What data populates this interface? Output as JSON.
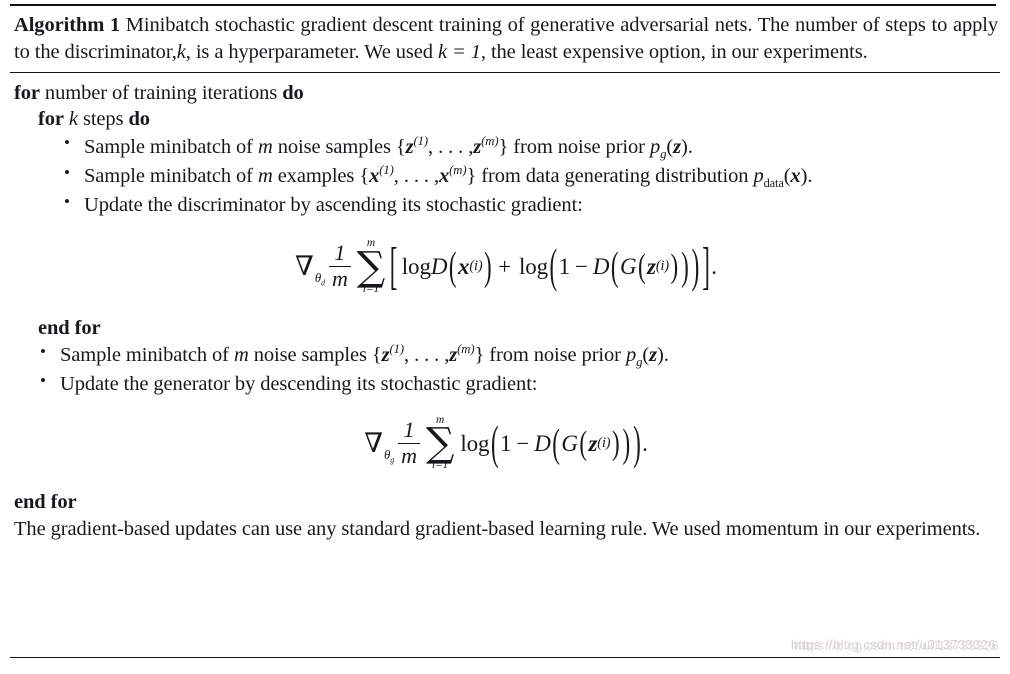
{
  "document": {
    "type": "algorithm-figure",
    "background_color": "#ffffff",
    "text_color": "#18181c",
    "rule_color": "#111118"
  },
  "caption": {
    "algorithm_label": "Algorithm 1",
    "title_part": "Minibatch stochastic gradient descent training of generative adversarial nets.",
    "note_part": "The number of steps to apply to the discriminator,",
    "k_symbol": "k",
    "note_mid": ", is a hyperparameter. We used",
    "k_value": "k = 1",
    "note_end": ", the least expensive option, in our experiments."
  },
  "algorithm": {
    "line_for_outer_pre": "for",
    "line_for_outer_text": "number of training iterations",
    "line_for_outer_post": "do",
    "line_for_inner_pre": "for",
    "line_for_inner_sym": "k",
    "line_for_inner_text": "steps",
    "line_for_inner_post": "do",
    "bullet1": {
      "text_a": "Sample minibatch of",
      "sym_m": "m",
      "text_b": "noise samples",
      "set_open": "{",
      "var1": "z",
      "sup1": "(1)",
      "ellipsis": ", . . . ,",
      "var2": "z",
      "sup2": "(m)",
      "set_close": "}",
      "text_c": "from noise prior",
      "prior_p": "p",
      "prior_sub": "g",
      "prior_arg_open": "(",
      "prior_arg": "z",
      "prior_arg_close": ")",
      "period": "."
    },
    "bullet2": {
      "text_a": "Sample minibatch of",
      "sym_m": "m",
      "text_b": "examples",
      "set_open": "{",
      "var1": "x",
      "sup1": "(1)",
      "ellipsis": ", . . . ,",
      "var2": "x",
      "sup2": "(m)",
      "set_close": "}",
      "text_c": "from data generating distribution",
      "dist_p": "p",
      "dist_sub": "data",
      "dist_arg_open": "(",
      "dist_arg": "x",
      "dist_arg_close": ")",
      "period": "."
    },
    "bullet3": {
      "text": "Update the discriminator by ascending its stochastic gradient:"
    },
    "end_for_inner": "end for",
    "bullet4": {
      "text_a": "Sample minibatch of",
      "sym_m": "m",
      "text_b": "noise samples",
      "set_open": "{",
      "var1": "z",
      "sup1": "(1)",
      "ellipsis": ", . . . ,",
      "var2": "z",
      "sup2": "(m)",
      "set_close": "}",
      "text_c": "from noise prior",
      "prior_p": "p",
      "prior_sub": "g",
      "prior_arg_open": "(",
      "prior_arg": "z",
      "prior_arg_close": ")",
      "period": "."
    },
    "bullet5": {
      "text": "Update the generator by descending its stochastic gradient:"
    },
    "end_for_outer": "end for",
    "closing_text": "The gradient-based updates can use any standard gradient-based learning rule. We used momentum in our experiments."
  },
  "equations": {
    "discriminator": {
      "latex": "\\nabla_{\\theta_d} \\frac{1}{m} \\sum_{i=1}^{m} \\left[ \\log D\\left(x^{(i)}\\right) + \\log\\left(1 - D\\left(G\\left(z^{(i)}\\right)\\right)\\right) \\right].",
      "nabla": "∇",
      "nabla_sub_theta": "θ",
      "nabla_sub_index": "d",
      "frac_num": "1",
      "frac_den": "m",
      "sum_symbol": "∑",
      "sum_upper": "m",
      "sum_lower": "i=1",
      "bracket_open": "[",
      "log1": "log",
      "func_D": "D",
      "paren_open": "(",
      "var_x": "x",
      "sup_i": "(i)",
      "paren_close": ")",
      "plus": "+",
      "log2": "log",
      "one": "1",
      "minus": "−",
      "func_D2": "D",
      "func_G": "G",
      "var_z": "z",
      "bracket_close": "]",
      "period": "."
    },
    "generator": {
      "latex": "\\nabla_{\\theta_g} \\frac{1}{m} \\sum_{i=1}^{m} \\log\\left(1 - D\\left(G\\left(z^{(i)}\\right)\\right)\\right).",
      "nabla": "∇",
      "nabla_sub_theta": "θ",
      "nabla_sub_index": "g",
      "frac_num": "1",
      "frac_den": "m",
      "sum_symbol": "∑",
      "sum_upper": "m",
      "sum_lower": "i=1",
      "log1": "log",
      "paren_open": "(",
      "one": "1",
      "minus": "−",
      "func_D": "D",
      "func_G": "G",
      "var_z": "z",
      "sup_i": "(i)",
      "paren_close": ")",
      "period": "."
    }
  },
  "watermark": {
    "text": "https://blog.csdn.net/u013733326",
    "color": "#cfcbc6"
  }
}
